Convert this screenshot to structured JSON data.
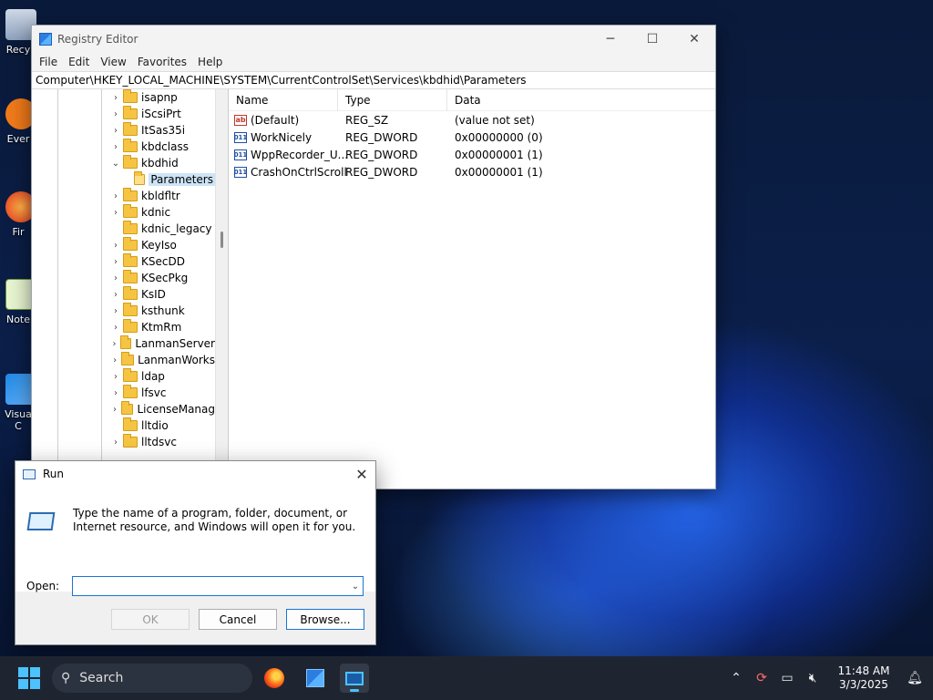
{
  "desktop": {
    "icons": [
      {
        "label": "Recy"
      },
      {
        "label": "Ever"
      },
      {
        "label": "Fir"
      },
      {
        "label": "Note"
      },
      {
        "label": "Visua"
      },
      {
        "label": "C"
      }
    ]
  },
  "regedit": {
    "title": "Registry Editor",
    "menu": [
      "File",
      "Edit",
      "View",
      "Favorites",
      "Help"
    ],
    "address": "Computer\\HKEY_LOCAL_MACHINE\\SYSTEM\\CurrentControlSet\\Services\\kbdhid\\Parameters",
    "tree": [
      {
        "label": "isapnp",
        "twisty": "›"
      },
      {
        "label": "iScsiPrt",
        "twisty": "›"
      },
      {
        "label": "ItSas35i",
        "twisty": "›"
      },
      {
        "label": "kbdclass",
        "twisty": "›"
      },
      {
        "label": "kbdhid",
        "twisty": "⌄"
      },
      {
        "label": "Parameters",
        "twisty": ""
      },
      {
        "label": "kbldfltr",
        "twisty": "›"
      },
      {
        "label": "kdnic",
        "twisty": "›"
      },
      {
        "label": "kdnic_legacy",
        "twisty": ""
      },
      {
        "label": "KeyIso",
        "twisty": "›"
      },
      {
        "label": "KSecDD",
        "twisty": "›"
      },
      {
        "label": "KSecPkg",
        "twisty": "›"
      },
      {
        "label": "KsID",
        "twisty": "›"
      },
      {
        "label": "ksthunk",
        "twisty": "›"
      },
      {
        "label": "KtmRm",
        "twisty": "›"
      },
      {
        "label": "LanmanServer",
        "twisty": "›"
      },
      {
        "label": "LanmanWorks",
        "twisty": "›"
      },
      {
        "label": "ldap",
        "twisty": "›"
      },
      {
        "label": "lfsvc",
        "twisty": "›"
      },
      {
        "label": "LicenseManag",
        "twisty": "›"
      },
      {
        "label": "lltdio",
        "twisty": ""
      },
      {
        "label": "lltdsvc",
        "twisty": "›"
      }
    ],
    "columns": {
      "name": "Name",
      "type": "Type",
      "data": "Data"
    },
    "values": [
      {
        "name": "(Default)",
        "icon": "ab",
        "type": "REG_SZ",
        "data": "(value not set)"
      },
      {
        "name": "WorkNicely",
        "icon": "011",
        "type": "REG_DWORD",
        "data": "0x00000000 (0)"
      },
      {
        "name": "WppRecorder_U...",
        "icon": "011",
        "type": "REG_DWORD",
        "data": "0x00000001 (1)"
      },
      {
        "name": "CrashOnCtrlScroll",
        "icon": "011",
        "type": "REG_DWORD",
        "data": "0x00000001 (1)"
      }
    ]
  },
  "run": {
    "title": "Run",
    "description": "Type the name of a program, folder, document, or Internet resource, and Windows will open it for you.",
    "open_label": "Open:",
    "open_value": "",
    "ok_label": "OK",
    "cancel_label": "Cancel",
    "browse_label": "Browse..."
  },
  "taskbar": {
    "search_label": "Search",
    "time": "11:48 AM",
    "date": "3/3/2025"
  }
}
